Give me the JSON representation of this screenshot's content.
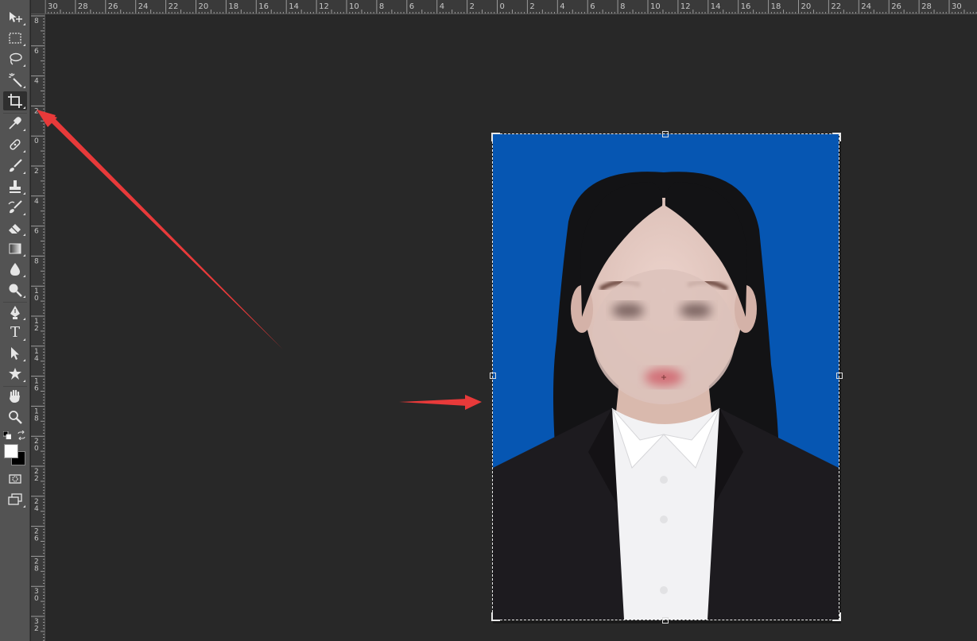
{
  "toolbar": {
    "tools": [
      {
        "name": "move-tool",
        "icon": "move-icon"
      },
      {
        "name": "marquee-tool",
        "icon": "rectangular-marquee-icon"
      },
      {
        "name": "lasso-tool",
        "icon": "lasso-icon"
      },
      {
        "name": "magic-wand-tool",
        "icon": "magic-wand-icon"
      },
      {
        "name": "crop-tool",
        "icon": "crop-icon",
        "active": true
      },
      {
        "name": "eyedropper-tool",
        "icon": "eyedropper-icon"
      },
      {
        "name": "healing-brush-tool",
        "icon": "bandage-icon"
      },
      {
        "name": "brush-tool",
        "icon": "brush-icon"
      },
      {
        "name": "clone-stamp-tool",
        "icon": "stamp-icon"
      },
      {
        "name": "history-brush-tool",
        "icon": "history-brush-icon"
      },
      {
        "name": "eraser-tool",
        "icon": "eraser-icon"
      },
      {
        "name": "gradient-tool",
        "icon": "gradient-icon"
      },
      {
        "name": "blur-tool",
        "icon": "drop-icon"
      },
      {
        "name": "dodge-tool",
        "icon": "dodge-icon"
      },
      {
        "name": "pen-tool",
        "icon": "pen-icon"
      },
      {
        "name": "type-tool",
        "icon": "type-icon",
        "label": "T"
      },
      {
        "name": "path-selection-tool",
        "icon": "arrow-cursor-icon"
      },
      {
        "name": "custom-shape-tool",
        "icon": "shape-icon"
      },
      {
        "name": "hand-tool",
        "icon": "hand-icon"
      },
      {
        "name": "zoom-tool",
        "icon": "magnifier-icon"
      },
      {
        "name": "quick-mask-button",
        "icon": "quick-mask-icon"
      },
      {
        "name": "screen-mode-button",
        "icon": "screen-mode-icon"
      }
    ],
    "foreground_color": "#ffffff",
    "background_color": "#000000"
  },
  "ruler_top": {
    "labels": [
      "30",
      "28",
      "26",
      "24",
      "22",
      "20",
      "18",
      "16",
      "14",
      "12",
      "10",
      "8",
      "6",
      "4",
      "2",
      "0",
      "2",
      "4",
      "6",
      "8",
      "10",
      "12",
      "14",
      "16",
      "18",
      "20",
      "22",
      "24",
      "26",
      "28",
      "30"
    ]
  },
  "ruler_left": {
    "labels": [
      "8",
      "6",
      "4",
      "2",
      "0",
      "2",
      "4",
      "6",
      "8",
      "10",
      "12",
      "14",
      "16",
      "18",
      "20",
      "22",
      "24",
      "26",
      "28",
      "30",
      "32"
    ]
  },
  "colors": {
    "photo_background": "#0656b2",
    "workspace": "#282828",
    "annotation_arrow": "#e83a3a"
  }
}
